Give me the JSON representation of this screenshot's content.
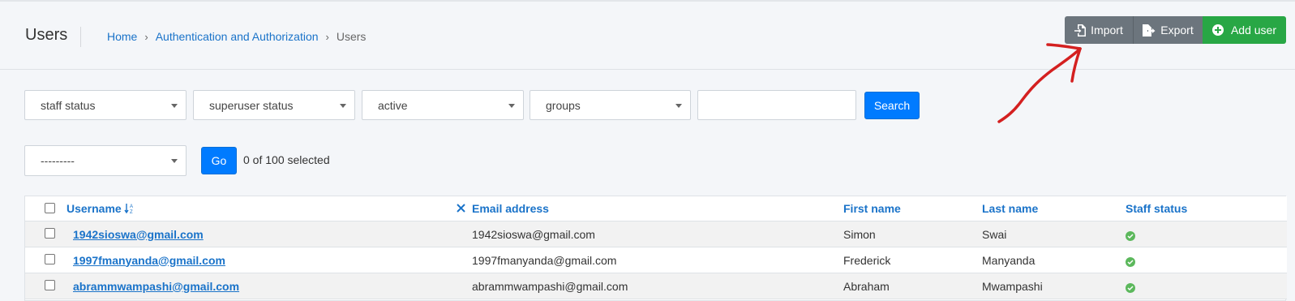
{
  "header": {
    "title": "Users",
    "breadcrumb": [
      "Home",
      "Authentication and Authorization",
      "Users"
    ],
    "buttons": {
      "import": "Import",
      "export": "Export",
      "add_user": "Add user"
    }
  },
  "filters": {
    "selects": [
      "staff status",
      "superuser status",
      "active",
      "groups"
    ],
    "search_value": "",
    "search_button": "Search"
  },
  "actions": {
    "select_value": "---------",
    "go_button": "Go",
    "selected_text": "0 of 100 selected"
  },
  "table": {
    "columns": [
      "Username",
      "Email address",
      "First name",
      "Last name",
      "Staff status"
    ],
    "rows": [
      {
        "username": "1942sioswa@gmail.com",
        "email": "1942sioswa@gmail.com",
        "first_name": "Simon",
        "last_name": "Swai",
        "staff_status": true
      },
      {
        "username": "1997fmanyanda@gmail.com",
        "email": "1997fmanyanda@gmail.com",
        "first_name": "Frederick",
        "last_name": "Manyanda",
        "staff_status": true
      },
      {
        "username": "abrammwampashi@gmail.com",
        "email": "abrammwampashi@gmail.com",
        "first_name": "Abraham",
        "last_name": "Mwampashi",
        "staff_status": true
      }
    ]
  },
  "colors": {
    "link": "#1a73c9",
    "primary": "#007bff",
    "secondary": "#6c757d",
    "success": "#28a745",
    "annotation": "#d42020"
  },
  "icons": {
    "import": "file-import-icon",
    "export": "file-export-icon",
    "add": "plus-circle-icon",
    "sort": "sort-alpha-icon",
    "remove_sort": "close-icon",
    "status_true": "check-circle-icon"
  }
}
